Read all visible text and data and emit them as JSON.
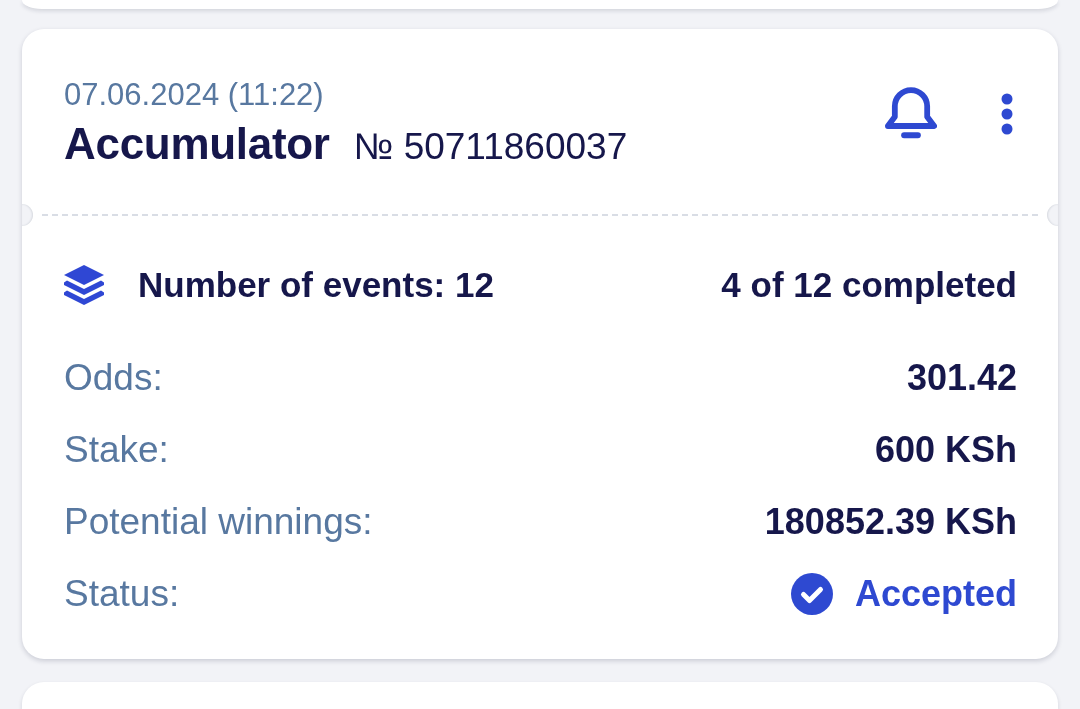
{
  "bet": {
    "date": "07.06.2024 (11:22)",
    "type": "Accumulator",
    "number": "№ 50711860037",
    "events": {
      "count": "Number of events: 12",
      "completed": "4 of 12 completed"
    },
    "details": [
      {
        "kind": "text",
        "label": "Odds:",
        "value": "301.42"
      },
      {
        "kind": "text",
        "label": "Stake:",
        "value": "600 KSh"
      },
      {
        "kind": "text",
        "label": "Potential winnings:",
        "value": "180852.39 KSh"
      },
      {
        "kind": "status",
        "label": "Status:",
        "value": "Accepted"
      }
    ]
  }
}
